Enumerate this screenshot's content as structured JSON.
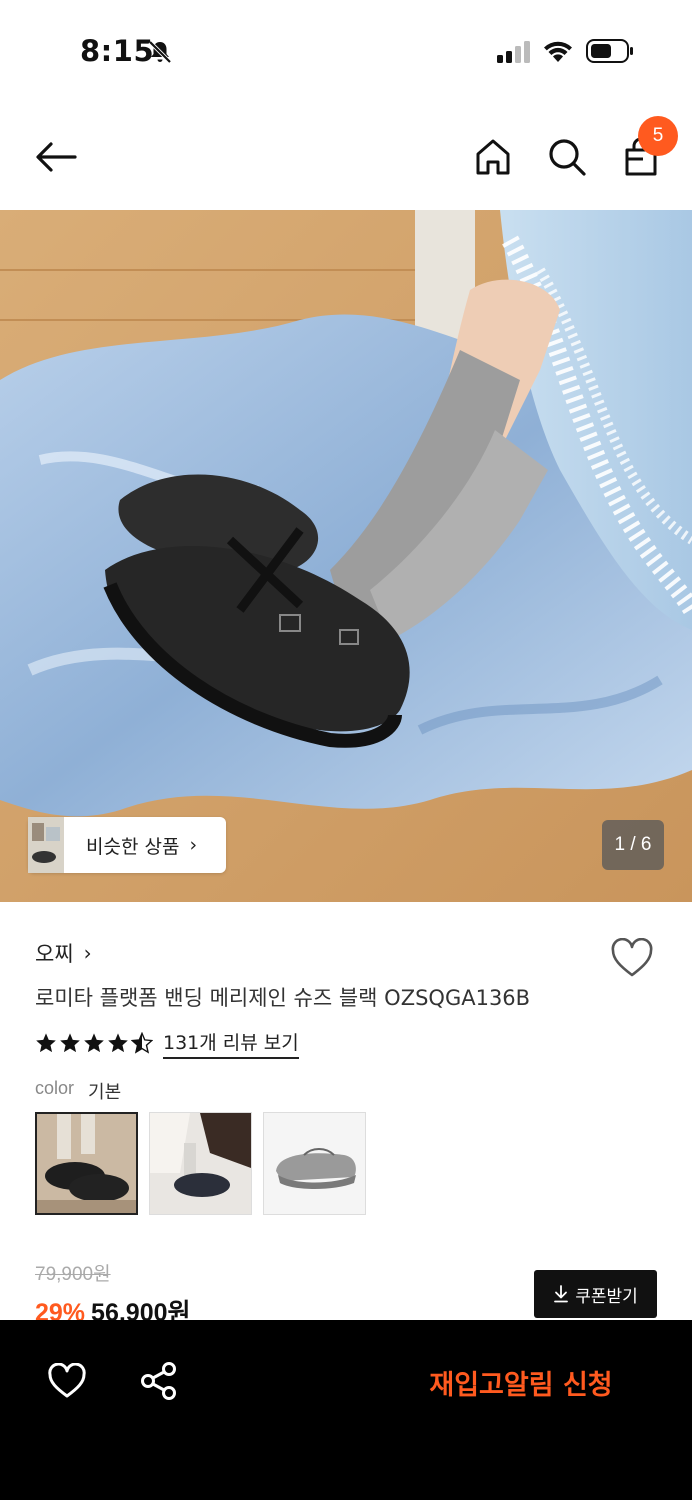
{
  "status_bar": {
    "time": "8:15",
    "icons": [
      "bell-off-icon",
      "signal-icon",
      "wifi-icon",
      "battery-icon"
    ]
  },
  "nav": {
    "back_icon": "arrow-left-icon",
    "home_icon": "home-icon",
    "search_icon": "search-icon",
    "cart_icon": "shopping-bag-icon",
    "cart_count": "5",
    "badge_color": "#ff5a1f"
  },
  "gallery": {
    "similar_label": "비슷한 상품",
    "similar_chevron": "›",
    "counter": "1 / 6"
  },
  "product": {
    "brand": "오찌",
    "brand_chevron": "›",
    "title": "로미타 플랫폼 밴딩 메리제인 슈즈 블랙 OZSQGA136B",
    "rating": 4.5,
    "review_link": "131개 리뷰 보기",
    "color_label": "color",
    "color_value": "기본",
    "swatch_count": 3,
    "original_price": "79,900원",
    "discount": "29%",
    "sale_price": "56,900원",
    "coupon_label": "쿠폰받기",
    "coupon_icon": "download-icon"
  },
  "bottom_bar": {
    "heart_icon": "heart-outline-icon",
    "share_icon": "share-icon",
    "restock_label": "재입고알림 신청",
    "accent_color": "#ff5a1f"
  }
}
